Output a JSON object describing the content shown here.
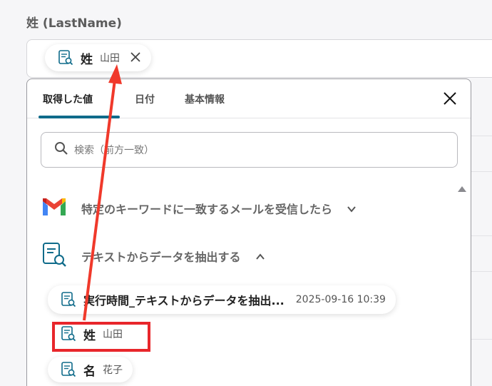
{
  "field": {
    "label": "姓 (LastName)"
  },
  "selected_chip": {
    "name": "姓",
    "value": "山田",
    "icon": "document-search-icon",
    "remove_icon": "close-icon"
  },
  "panel": {
    "tabs": [
      {
        "label": "取得した値",
        "active": true
      },
      {
        "label": "日付",
        "active": false
      },
      {
        "label": "基本情報",
        "active": false
      }
    ],
    "close_icon": "close-icon",
    "search": {
      "placeholder": "検索（前方一致）",
      "icon": "search-icon"
    },
    "sections": [
      {
        "title": "特定のキーワードに一致するメールを受信したら",
        "icon": "gmail-icon",
        "expanded": false
      },
      {
        "title": "テキストからデータを抽出する",
        "icon": "document-search-icon",
        "expanded": true
      }
    ],
    "items": [
      {
        "name": "実行時間_テキストからデータを抽出...",
        "value": "2025-09-16 10:39"
      },
      {
        "name": "姓",
        "value": "山田"
      },
      {
        "name": "名",
        "value": "花子"
      }
    ]
  },
  "colors": {
    "accent": "#0f6b8a",
    "highlight": "#e8262b",
    "arrow": "#f0392b"
  }
}
